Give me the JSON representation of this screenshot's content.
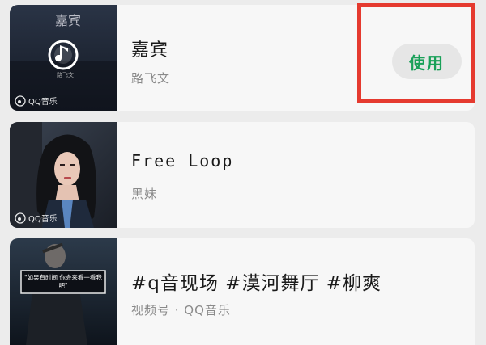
{
  "items": [
    {
      "title": "嘉宾",
      "subtitle": "路飞文",
      "badge": "QQ音乐",
      "cover_title": "嘉宾",
      "cover_artist": "路飞文",
      "action_label": "使用"
    },
    {
      "title": "Free Loop",
      "subtitle": "黑妹",
      "badge": "QQ音乐"
    },
    {
      "title": "#q音现场 #漠河舞厅 #柳爽",
      "subtitle": "视频号 · QQ音乐",
      "cover_caption": "\"如果有时间 你会来看一看我吧\""
    }
  ],
  "colors": {
    "accent_green": "#18a058",
    "highlight_red": "#e53a2f"
  }
}
